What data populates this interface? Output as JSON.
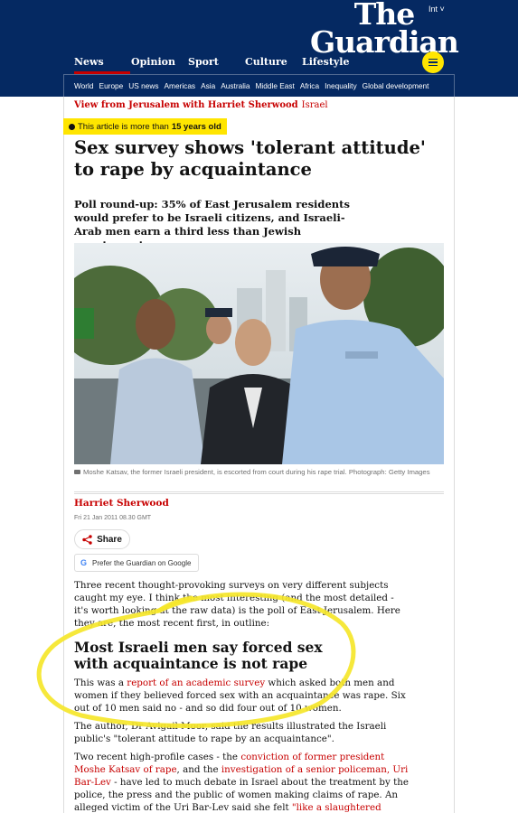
{
  "header": {
    "edition": "Int",
    "logo_line1": "The",
    "logo_line2": "Guardian",
    "pillars": [
      "News",
      "Opinion",
      "Sport",
      "Culture",
      "Lifestyle"
    ],
    "subnav": [
      "World",
      "Europe",
      "US news",
      "Americas",
      "Asia",
      "Australia",
      "Middle East",
      "Africa",
      "Inequality",
      "Global development"
    ],
    "brand_color": "#052962",
    "accent_color": "#c70000"
  },
  "article": {
    "series": "View from Jerusalem with Harriet Sherwood",
    "tag": "Israel",
    "age_warning_prefix": "This article is more than",
    "age_warning_bold": "15 years old",
    "headline": "Sex survey shows 'tolerant attitude' to rape by acquaintance",
    "standfirst": "Poll round-up: 35% of East Jerusalem residents would prefer to be Israeli citizens, and Israeli-Arab men earn a third less than Jewish counterparts",
    "caption": "Moshe Katsav, the former Israeli president, is escorted from court during his rape trial. Photograph: Getty Images",
    "byline": "Harriet Sherwood",
    "date": "Fri 21 Jan 2011 08.30 GMT",
    "share_label": "Share",
    "google_label": "Prefer the Guardian on Google",
    "p1": "Three recent thought-provoking surveys on very different subjects caught my eye. I think the most interesting (and the most detailed - it's worth looking at the raw data) is the poll of East Jerusalem. Here they are, the most recent first, in outline:",
    "subhead": "Most Israeli men say forced sex with acquaintance is not rape",
    "p2_a": "This was a ",
    "p2_link": "report of an academic survey",
    "p2_b": " which asked both men and women if they believed forced sex with an acquaintance was rape. Six out of 10 men said no - and so did four out of 10 women.",
    "p3": "The author, Dr Avigail Moor, said the results illustrated the Israeli public's \"tolerant attitude to rape by an acquaintance\".",
    "p4_a": "Two recent high-profile cases - the ",
    "p4_link1": "conviction of former president Moshe Katsav of rape",
    "p4_b": ", and the ",
    "p4_link2": "investigation of a senior policeman, Uri Bar-Lev",
    "p4_c": " - have led to much debate in Israel about the treatment by the police, the press and the public of women making claims of rape. An alleged victim of the Uri Bar-Lev said she felt ",
    "p4_link3": "\"like a slaughtered chicken\"",
    "p4_d": "."
  },
  "icons": {
    "clock": "clock-icon",
    "share": "share-icon",
    "google": "google-icon",
    "menu": "menu-icon",
    "camera": "camera-icon"
  }
}
